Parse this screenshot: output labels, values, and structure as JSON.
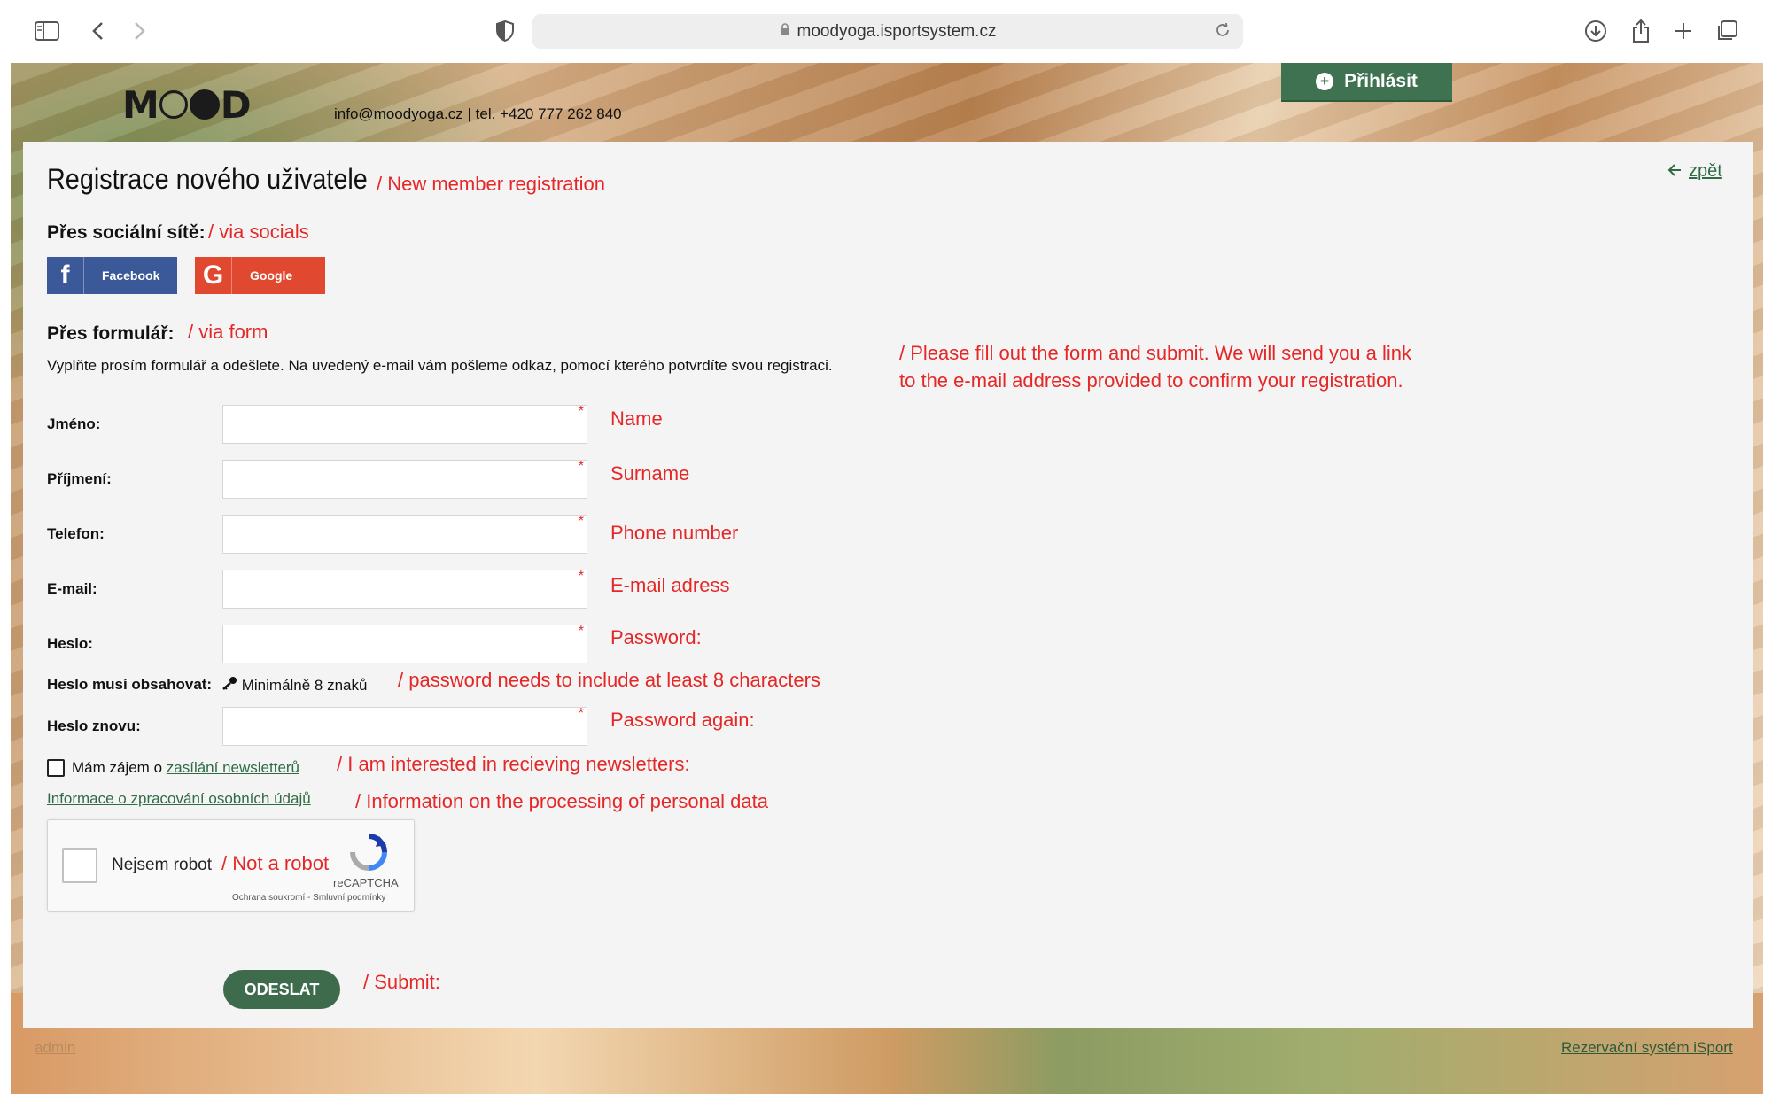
{
  "browser": {
    "url": "moodyoga.isportsystem.cz"
  },
  "header": {
    "logo_text": "MOOD",
    "email": "info@moodyoga.cz",
    "separator": "| tel.",
    "phone": "+420 777 262 840",
    "login_label": "Přihlásit"
  },
  "panel": {
    "title": "Registrace nového uživatele",
    "title_translation": "/ New member registration",
    "back_label": "zpět",
    "social_heading": "Přes sociální sítě:",
    "social_translation": "/ via socials",
    "facebook_label": "Facebook",
    "google_label": "Google",
    "form_heading": "Přes formulář:",
    "form_translation": "/ via form",
    "description": "Vyplňte prosím formulář a odešlete. Na uvedený e-mail vám pošleme odkaz, pomocí kterého potvrdíte svou registraci.",
    "description_translation_line1": "/ Please fill out the form and submit. We will send you a link",
    "description_translation_line2": "to the e-mail address provided to confirm your registration."
  },
  "form": {
    "required_mark": "*",
    "fields": [
      {
        "label": "Jméno:",
        "translation": "Name",
        "value": ""
      },
      {
        "label": "Příjmení:",
        "translation": "Surname",
        "value": ""
      },
      {
        "label": "Telefon:",
        "translation": "Phone number",
        "value": ""
      },
      {
        "label": "E-mail:",
        "translation": "E-mail adress",
        "value": ""
      },
      {
        "label": "Heslo:",
        "translation": "Password:",
        "value": ""
      }
    ],
    "password_rule_label": "Heslo musí obsahovat:",
    "password_rule_text": "Minimálně 8 znaků",
    "password_rule_translation": "/ password needs to include at least 8 characters",
    "password_again_label": "Heslo znovu:",
    "password_again_translation": "Password again:",
    "newsletter_text": "Mám zájem o",
    "newsletter_link": "zasílání newsletterů",
    "newsletter_translation": "/ I am interested in recieving newsletters:",
    "newsletter_checked": false,
    "privacy_link": "Informace o zpracování osobních údajů",
    "privacy_translation": "/ Information on the processing of personal data",
    "captcha_label": "Nejsem robot",
    "captcha_translation": "/ Not a robot",
    "captcha_brand": "reCAPTCHA",
    "captcha_terms": "Ochrana soukromí - Smluvní podmínky",
    "submit_label": "ODESLAT",
    "submit_translation": "/ Submit:"
  },
  "footer": {
    "admin_label": "admin",
    "isport_label": "Rezervační systém iSport"
  },
  "colors": {
    "accent_green": "#3e7250",
    "translation_red": "#e52727",
    "facebook_blue": "#3b5998",
    "google_red": "#e04830"
  }
}
